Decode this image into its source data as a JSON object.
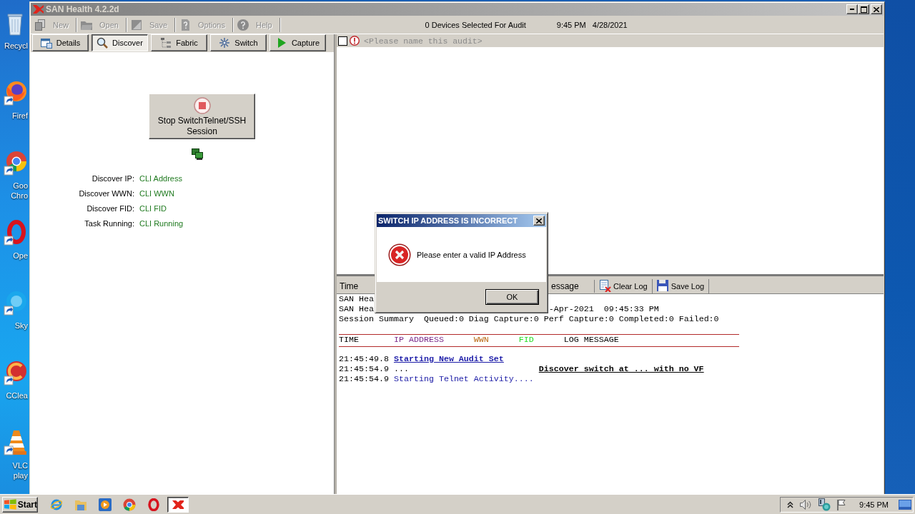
{
  "desktop": {
    "icons": [
      {
        "kind": "bin",
        "lines": [
          "Recycl"
        ]
      },
      {
        "kind": "firefox",
        "lines": [
          "Firef"
        ]
      },
      {
        "kind": "chrome",
        "lines": [
          "Goo",
          "Chro"
        ]
      },
      {
        "kind": "opera",
        "lines": [
          "Ope"
        ]
      },
      {
        "kind": "skype",
        "lines": [
          "Sky"
        ]
      },
      {
        "kind": "ccleaner",
        "lines": [
          "CClea"
        ]
      },
      {
        "kind": "vlc",
        "lines": [
          "VLC",
          "play"
        ]
      }
    ]
  },
  "window": {
    "title": "SAN Health 4.2.2d"
  },
  "toolbar": {
    "buttons": [
      {
        "kind": "new",
        "label": "New",
        "disabled": true
      },
      {
        "kind": "open",
        "label": "Open",
        "disabled": true
      },
      {
        "kind": "save",
        "label": "Save",
        "disabled": true
      },
      {
        "kind": "options",
        "label": "Options",
        "disabled": true
      },
      {
        "kind": "help",
        "label": "Help",
        "disabled": true
      }
    ],
    "status": "0 Devices Selected For Audit",
    "time": "9:45 PM",
    "date": "4/28/2021"
  },
  "tabs": [
    {
      "kind": "details",
      "label": "Details",
      "selected": false
    },
    {
      "kind": "discover",
      "label": "Discover",
      "selected": true
    },
    {
      "kind": "fabric",
      "label": "Fabric",
      "selected": false
    },
    {
      "kind": "switch",
      "label": "Switch",
      "selected": false
    },
    {
      "kind": "capture",
      "label": "Capture",
      "selected": false
    }
  ],
  "discover_panel": {
    "stop_button": {
      "lines": [
        "Stop SwitchTelnet/SSH",
        "Session"
      ]
    },
    "fields": [
      {
        "label": "Discover IP:",
        "value": "CLI Address"
      },
      {
        "label": "Discover WWN:",
        "value": "CLI WWN"
      },
      {
        "label": "Discover FID:",
        "value": "CLI FID"
      },
      {
        "label": "Task Running:",
        "value": "CLI Running"
      }
    ]
  },
  "audit": {
    "checked": false,
    "placeholder": "<Please name this audit>"
  },
  "log": {
    "columns": [
      "Time",
      "essage"
    ],
    "actions": [
      {
        "kind": "clear",
        "label": "Clear Log"
      },
      {
        "kind": "save",
        "label": "Save Log"
      }
    ],
    "summary": [
      {
        "start": "SAN Hea"
      },
      {
        "start": "SAN Hea",
        "end": "-Apr-2021  09:45:33 PM"
      },
      {
        "start": "Session Summary  Queued:0 Diag Capture:0 Perf Capture:0 Completed:0 Failed:0"
      }
    ],
    "header": [
      {
        "label": "TIME",
        "color": "#000000"
      },
      {
        "label": "IP ADDRESS",
        "color": "#7a2a8a"
      },
      {
        "label": "WWN",
        "color": "#b8650f"
      },
      {
        "label": "FID",
        "color": "#22dd22"
      },
      {
        "label": "LOG MESSAGE",
        "color": "#000000"
      }
    ],
    "entries": [
      {
        "kind": "title",
        "time": "21:45:49.8",
        "message": "Starting New Audit Set"
      },
      {
        "kind": "notice",
        "time": "21:45:54.9",
        "address": "...",
        "message": "Discover switch at ... with no VF"
      },
      {
        "kind": "plain",
        "time": "21:45:54.9",
        "message": "Starting Telnet Activity...."
      }
    ]
  },
  "dialog": {
    "title": "SWITCH IP ADDRESS IS INCORRECT",
    "message": "Please enter a valid IP Address",
    "button": "OK"
  },
  "taskbar": {
    "start": "Start",
    "apps": [
      {
        "kind": "ie",
        "active": false
      },
      {
        "kind": "explorer",
        "active": false
      },
      {
        "kind": "media",
        "active": false
      },
      {
        "kind": "chrome",
        "active": false
      },
      {
        "kind": "opera",
        "active": false
      },
      {
        "kind": "sanhealth",
        "active": true
      }
    ],
    "clock": "9:45 PM"
  }
}
